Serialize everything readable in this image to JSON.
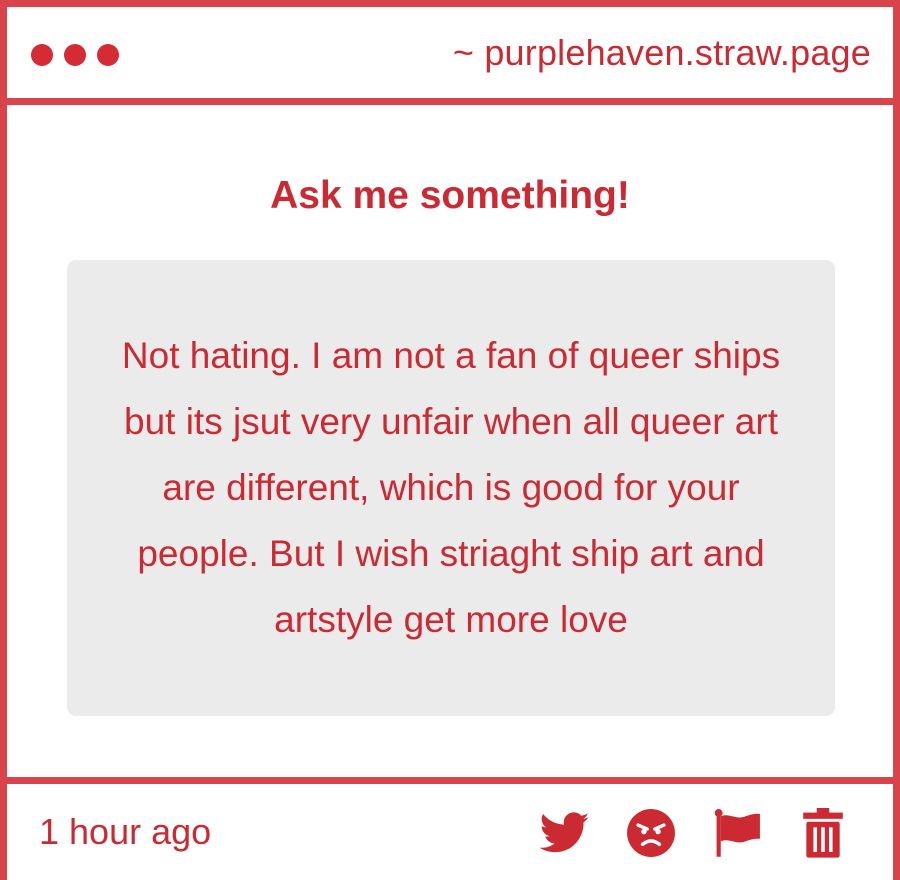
{
  "window": {
    "url": "~ purplehaven.straw.page",
    "controls": [
      "close",
      "minimize",
      "maximize"
    ]
  },
  "ask": {
    "heading": "Ask me something!",
    "question": "Not hating. I am not a fan of queer ships but its jsut very unfair when all queer art are different, which is good for your people. But I wish striaght ship art and artstyle get more love"
  },
  "footer": {
    "timestamp": "1 hour ago",
    "actions": [
      "twitter-icon",
      "angry-face-icon",
      "flag-icon",
      "trash-icon"
    ]
  },
  "colors": {
    "accent": "#cc2a33",
    "border": "#d9444c",
    "question_bg": "#ecebec"
  }
}
